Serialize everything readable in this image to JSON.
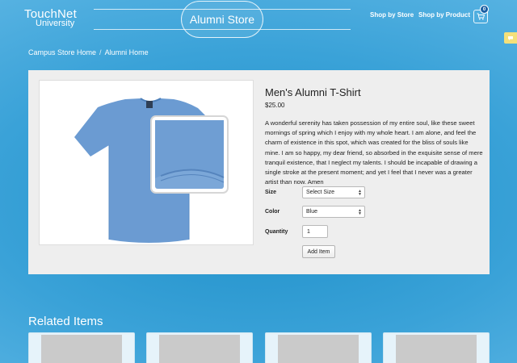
{
  "header": {
    "logo_line1": "TouchNet",
    "logo_line2": "University",
    "store_title": "Alumni Store",
    "nav": [
      "Shop by Store",
      "Shop by Product"
    ],
    "cart_count": "0"
  },
  "breadcrumb": [
    "Campus Store Home",
    "Alumni Home"
  ],
  "product": {
    "title": "Men's Alumni T-Shirt",
    "price": "$25.00",
    "description": "A wonderful serenity has taken possession of my entire soul, like these sweet mornings of spring which I enjoy with my whole heart. I am alone, and feel the charm of existence in this spot, which was created for the bliss of souls like mine. I am so happy, my dear friend, so absorbed in the exquisite sense of mere tranquil existence, that I neglect my talents. I should be incapable of drawing a single stroke at the present moment; and yet I feel that I never was a greater artist than now. Amen",
    "size_label": "Size",
    "size_value": "Select Size",
    "color_label": "Color",
    "color_value": "Blue",
    "qty_label": "Quantity",
    "qty_value": "1",
    "add_button": "Add Item"
  },
  "related": {
    "title": "Related Items",
    "count": 4
  },
  "colors": {
    "accent": "#1d8fc8",
    "panel": "#eeeeee",
    "shirt": "#6b9bd2",
    "cart_badge": "#1a5fa3"
  }
}
